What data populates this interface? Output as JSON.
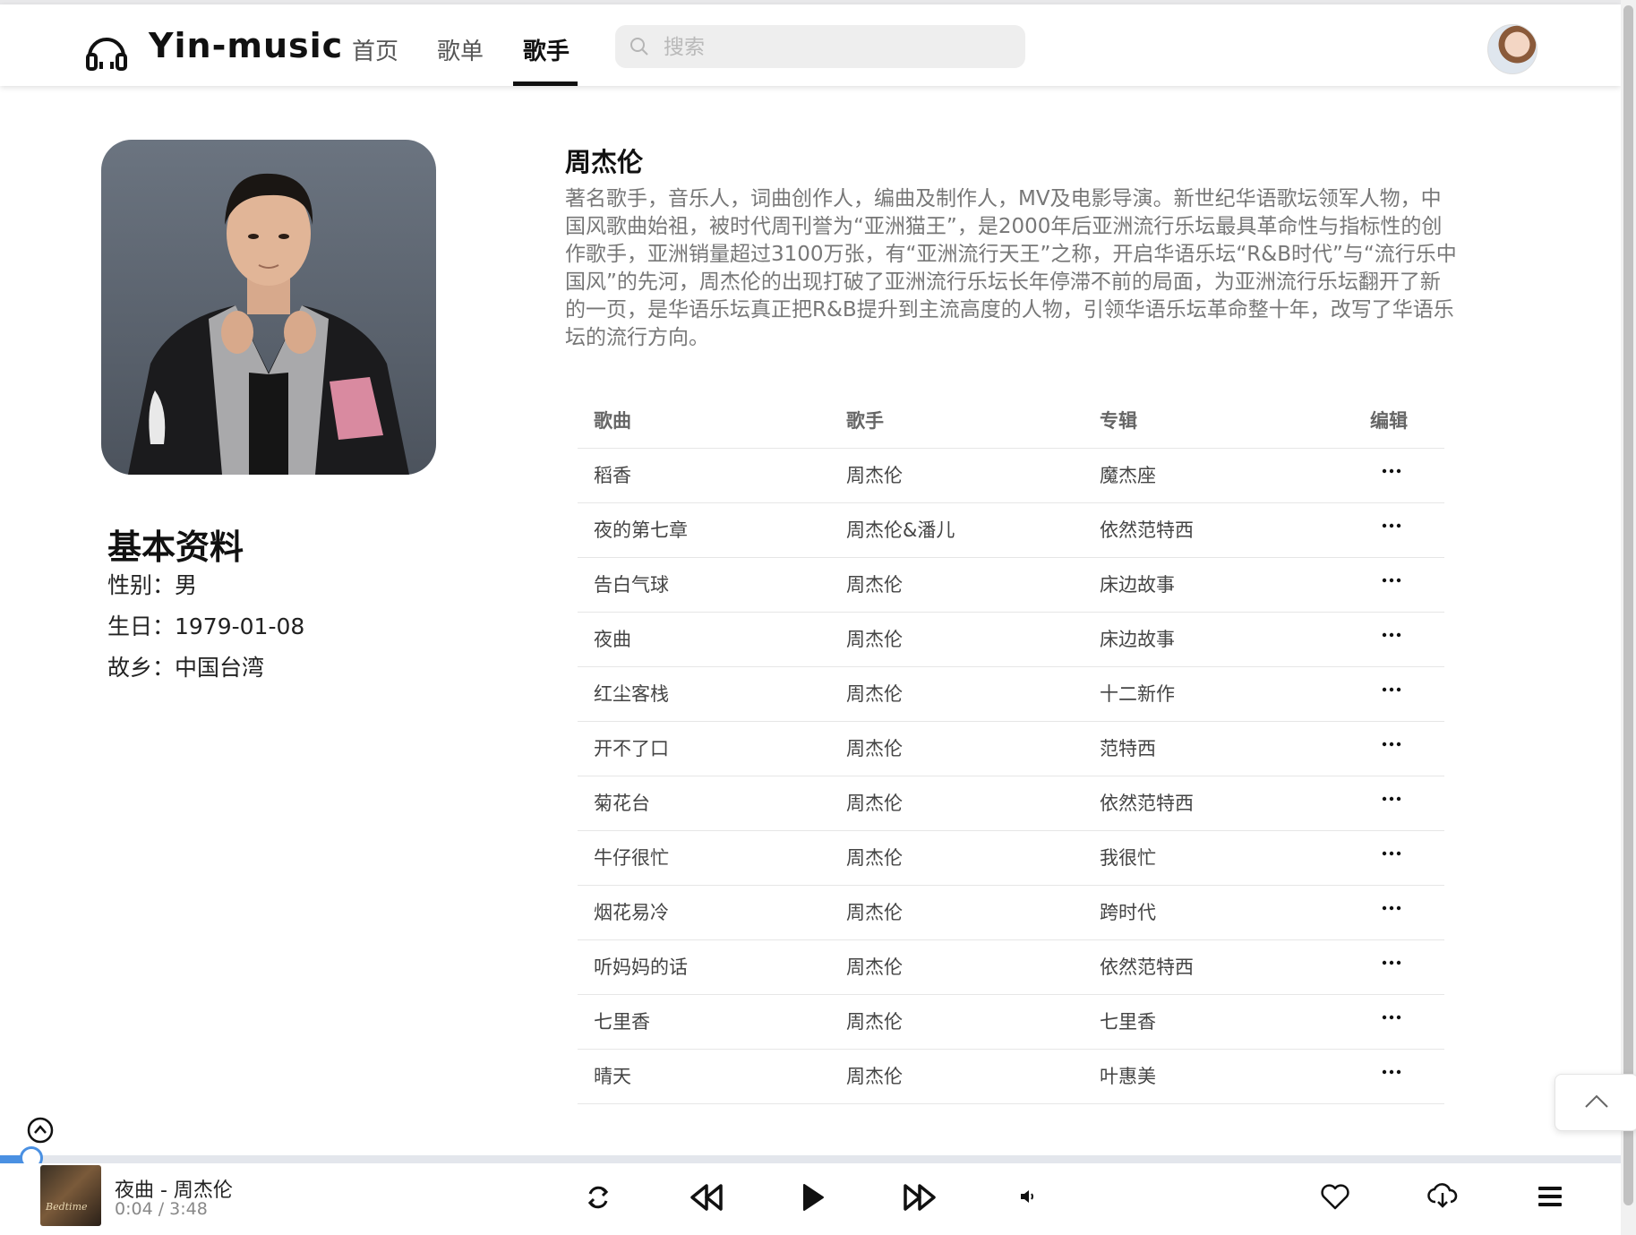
{
  "app": {
    "title": "Yin-music",
    "nav": [
      "首页",
      "歌单",
      "歌手"
    ],
    "active_nav": "歌手",
    "search_placeholder": "搜索"
  },
  "singer": {
    "name": "周杰伦",
    "intro": "著名歌手，音乐人，词曲创作人，编曲及制作人，MV及电影导演。新世纪华语歌坛领军人物，中国风歌曲始祖，被时代周刊誉为“亚洲猫王”，是2000年后亚洲流行乐坛最具革命性与指标性的创作歌手，亚洲销量超过3100万张，有“亚洲流行天王”之称，开启华语乐坛“R&B时代”与“流行乐中国风”的先河，周杰伦的出现打破了亚洲流行乐坛长年停滞不前的局面，为亚洲流行乐坛翻开了新的一页，是华语乐坛真正把R&B提升到主流高度的人物，引领华语乐坛革命整十年，改写了华语乐坛的流行方向。",
    "info_title": "基本资料",
    "gender": "性别：男",
    "birthday": "生日：1979-01-08",
    "hometown": "故乡：中国台湾"
  },
  "table": {
    "headers": [
      "歌曲",
      "歌手",
      "专辑",
      "编辑"
    ],
    "rows": [
      {
        "song": "稻香",
        "singer": "周杰伦",
        "album": "魔杰座"
      },
      {
        "song": "夜的第七章",
        "singer": "周杰伦&潘儿",
        "album": "依然范特西"
      },
      {
        "song": "告白气球",
        "singer": "周杰伦",
        "album": "床边故事"
      },
      {
        "song": "夜曲",
        "singer": "周杰伦",
        "album": "床边故事"
      },
      {
        "song": "红尘客栈",
        "singer": "周杰伦",
        "album": "十二新作"
      },
      {
        "song": "开不了口",
        "singer": "周杰伦",
        "album": "范特西"
      },
      {
        "song": "菊花台",
        "singer": "周杰伦",
        "album": "依然范特西"
      },
      {
        "song": "牛仔很忙",
        "singer": "周杰伦",
        "album": "我很忙"
      },
      {
        "song": "烟花易冷",
        "singer": "周杰伦",
        "album": "跨时代"
      },
      {
        "song": "听妈妈的话",
        "singer": "周杰伦",
        "album": "依然范特西"
      },
      {
        "song": "七里香",
        "singer": "周杰伦",
        "album": "七里香"
      },
      {
        "song": "晴天",
        "singer": "周杰伦",
        "album": "叶惠美"
      }
    ]
  },
  "player": {
    "now_playing": "夜曲 - 周杰伦",
    "time": "0:04 / 3:48",
    "progress": 0.017,
    "accent_color": "#4a90e2",
    "icons": [
      "loop-icon",
      "previous-icon",
      "play-icon",
      "next-icon",
      "volume-icon",
      "heart-icon",
      "download-icon",
      "playlist-icon"
    ]
  }
}
